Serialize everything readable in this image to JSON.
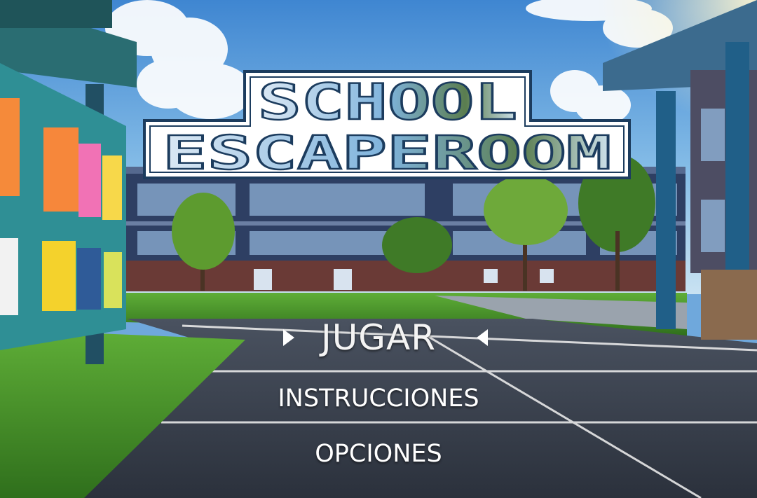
{
  "game": {
    "title_line1": "SCHOOL",
    "title_line2": "ESCAPEROOM"
  },
  "menu": {
    "items": [
      {
        "label": "JUGAR",
        "selected": true
      },
      {
        "label": "INSTRUCCIONES",
        "selected": false
      },
      {
        "label": "OPCIONES",
        "selected": false
      }
    ]
  },
  "scene": {
    "description_icons": [
      "school-building",
      "bulletin-board",
      "courtyard"
    ]
  },
  "colors": {
    "sky": "#5d9ad6",
    "grass": "#4f9a2f",
    "asphalt": "#3a4250",
    "logo_outline": "#1c3c5e",
    "menu_text": "#ffffff"
  }
}
